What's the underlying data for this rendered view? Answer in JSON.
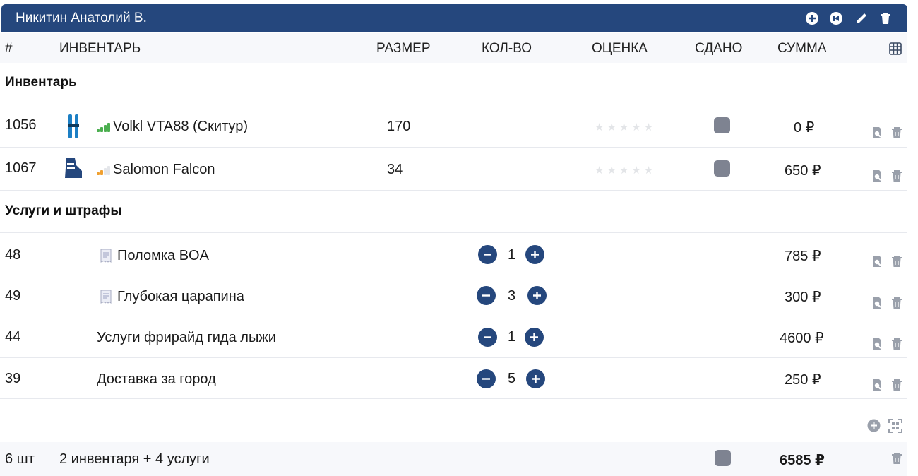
{
  "header": {
    "title": "Никитин Анатолий В.",
    "icons": [
      "plus-circle-icon",
      "skip-back-icon",
      "pencil-icon",
      "trash-icon"
    ]
  },
  "columns": {
    "num": "#",
    "item": "ИНВЕНТАРЬ",
    "size": "РАЗМЕР",
    "qty": "КОЛ-ВО",
    "rating": "ОЦЕНКА",
    "returned": "СДАНО",
    "sum": "СУММА"
  },
  "sections": {
    "inventory": "Инвентарь",
    "services": "Услуги и штрафы"
  },
  "inventory": [
    {
      "id": "1056",
      "icon": "ski-icon",
      "signal_color": "#4caf50",
      "name": "Volkl VTA88 (Скитур)",
      "size": "170",
      "stars": "★★★★★",
      "sum": "0 ₽"
    },
    {
      "id": "1067",
      "icon": "ski-boot-icon",
      "signal_color": "#f0a030",
      "name": "Salomon Falcon",
      "size": "34",
      "stars": "★★★★★",
      "sum": "650 ₽"
    }
  ],
  "services": [
    {
      "id": "48",
      "icon": "receipt-icon",
      "name": "Поломка BOA",
      "qty": "1",
      "sum": "785 ₽"
    },
    {
      "id": "49",
      "icon": "receipt-icon",
      "name": "Глубокая царапина",
      "qty": "3",
      "sum": "300 ₽"
    },
    {
      "id": "44",
      "icon": "",
      "name": "Услуги фрирайд гида лыжи",
      "qty": "1",
      "sum": "4600 ₽"
    },
    {
      "id": "39",
      "icon": "",
      "name": "Доставка за город",
      "qty": "5",
      "sum": "250 ₽"
    }
  ],
  "footer": {
    "count": "6 шт",
    "summary": "2 инвентаря + 4 услуги",
    "total": "6585 ₽"
  },
  "colors": {
    "header_bg": "#25477d",
    "button": "#25477d",
    "checkbox": "#7e8391"
  }
}
